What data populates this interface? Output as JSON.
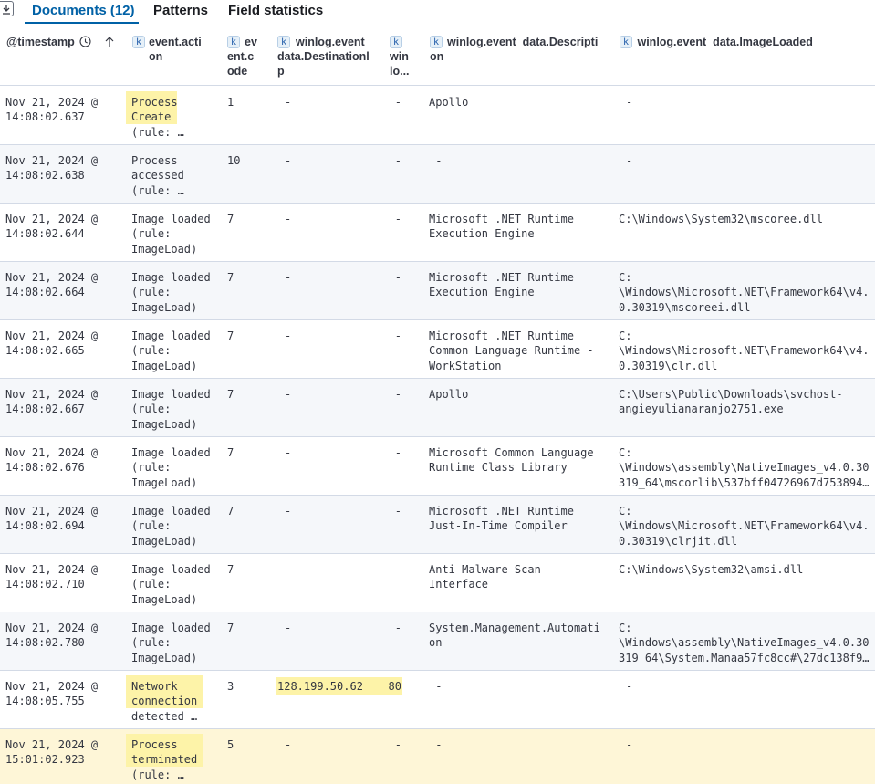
{
  "tabs": {
    "documents": "Documents (12)",
    "patterns": "Patterns",
    "field_statistics": "Field statistics"
  },
  "columns": {
    "timestamp": "@timestamp",
    "event_action": "event.action",
    "event_code": "event.code",
    "destination_ip": "winlog.event_data.DestinationIp",
    "winlog_short": "winlog...",
    "description": "winlog.event_data.Description",
    "image_loaded": "winlog.event_data.ImageLoaded"
  },
  "column_display": {
    "event_action": [
      "event.acti",
      "on"
    ],
    "event_code": [
      "ev",
      "ent.c",
      "ode"
    ],
    "destination_ip": [
      "winlog.event_",
      "data.Destinationl",
      "p"
    ],
    "winlog_short": [
      "win",
      "lo..."
    ],
    "description": [
      "winlog.event_data.Descripti",
      "on"
    ]
  },
  "field_type_token": "k",
  "rows": [
    {
      "ts": [
        "Nov 21, 2024 @",
        "14:08:02.637"
      ],
      "action": [
        "Process",
        "Create",
        "(rule: …"
      ],
      "code": "1",
      "dst": "-",
      "port": "-",
      "desc": [
        "Apollo"
      ],
      "image": [
        "-"
      ],
      "highlight_action": 2
    },
    {
      "ts": [
        "Nov 21, 2024 @",
        "14:08:02.638"
      ],
      "action": [
        "Process",
        "accessed",
        "(rule: …"
      ],
      "code": "10",
      "dst": "-",
      "port": "-",
      "desc": [
        " -"
      ],
      "image": [
        "-"
      ]
    },
    {
      "ts": [
        "Nov 21, 2024 @",
        "14:08:02.644"
      ],
      "action": [
        "Image loaded",
        "(rule:",
        "ImageLoad)"
      ],
      "code": "7",
      "dst": "-",
      "port": "-",
      "desc": [
        "Microsoft .NET Runtime",
        "Execution Engine"
      ],
      "image": [
        "C:\\Windows\\System32\\mscoree.dll"
      ]
    },
    {
      "ts": [
        "Nov 21, 2024 @",
        "14:08:02.664"
      ],
      "action": [
        "Image loaded",
        "(rule:",
        "ImageLoad)"
      ],
      "code": "7",
      "dst": "-",
      "port": "-",
      "desc": [
        "Microsoft .NET Runtime",
        "Execution Engine"
      ],
      "image": [
        "C:",
        "\\Windows\\Microsoft.NET\\Framework64\\v4.",
        "0.30319\\mscoreei.dll"
      ]
    },
    {
      "ts": [
        "Nov 21, 2024 @",
        "14:08:02.665"
      ],
      "action": [
        "Image loaded",
        "(rule:",
        "ImageLoad)"
      ],
      "code": "7",
      "dst": "-",
      "port": "-",
      "desc": [
        "Microsoft .NET Runtime",
        "Common Language Runtime -",
        "WorkStation"
      ],
      "image": [
        "C:",
        "\\Windows\\Microsoft.NET\\Framework64\\v4.",
        "0.30319\\clr.dll"
      ]
    },
    {
      "ts": [
        "Nov 21, 2024 @",
        "14:08:02.667"
      ],
      "action": [
        "Image loaded",
        "(rule:",
        "ImageLoad)"
      ],
      "code": "7",
      "dst": "-",
      "port": "-",
      "desc": [
        "Apollo"
      ],
      "image": [
        "C:\\Users\\Public\\Downloads\\svchost-",
        "angieyulianaranjo2751.exe"
      ]
    },
    {
      "ts": [
        "Nov 21, 2024 @",
        "14:08:02.676"
      ],
      "action": [
        "Image loaded",
        "(rule:",
        "ImageLoad)"
      ],
      "code": "7",
      "dst": "-",
      "port": "-",
      "desc": [
        "Microsoft Common Language",
        "Runtime Class Library"
      ],
      "image": [
        "C:",
        "\\Windows\\assembly\\NativeImages_v4.0.30",
        "319_64\\mscorlib\\537bff04726967d753894…"
      ]
    },
    {
      "ts": [
        "Nov 21, 2024 @",
        "14:08:02.694"
      ],
      "action": [
        "Image loaded",
        "(rule:",
        "ImageLoad)"
      ],
      "code": "7",
      "dst": "-",
      "port": "-",
      "desc": [
        "Microsoft .NET Runtime",
        "Just-In-Time Compiler"
      ],
      "image": [
        "C:",
        "\\Windows\\Microsoft.NET\\Framework64\\v4.",
        "0.30319\\clrjit.dll"
      ]
    },
    {
      "ts": [
        "Nov 21, 2024 @",
        "14:08:02.710"
      ],
      "action": [
        "Image loaded",
        "(rule:",
        "ImageLoad)"
      ],
      "code": "7",
      "dst": "-",
      "port": "-",
      "desc": [
        "Anti-Malware Scan",
        "Interface"
      ],
      "image": [
        "C:\\Windows\\System32\\amsi.dll"
      ]
    },
    {
      "ts": [
        "Nov 21, 2024 @",
        "14:08:02.780"
      ],
      "action": [
        "Image loaded",
        "(rule:",
        "ImageLoad)"
      ],
      "code": "7",
      "dst": "-",
      "port": "-",
      "desc": [
        "System.Management.Automati",
        "on"
      ],
      "image": [
        "C:",
        "\\Windows\\assembly\\NativeImages_v4.0.30",
        "319_64\\System.Manaa57fc8cc#\\27dc138f9…"
      ]
    },
    {
      "ts": [
        "Nov 21, 2024 @",
        "14:08:05.755"
      ],
      "action": [
        "Network",
        "connection",
        "detected …"
      ],
      "code": "3",
      "dst": "128.199.50.62",
      "port": "80",
      "desc": [
        " -"
      ],
      "image": [
        "-"
      ],
      "highlight_action": 2,
      "highlight_dst": true
    },
    {
      "ts": [
        "Nov 21, 2024 @",
        "15:01:02.923"
      ],
      "action": [
        "Process",
        "terminated",
        "(rule: …"
      ],
      "code": "5",
      "dst": "-",
      "port": "-",
      "desc": [
        " -"
      ],
      "image": [
        "-"
      ],
      "highlight_action": 2,
      "row_highlight": true
    }
  ],
  "colors": {
    "accent": "#0061a6",
    "highlight": "#fdf3a8",
    "row_highlight": "#fef6d7",
    "alt_row": "#f5f7fa"
  }
}
